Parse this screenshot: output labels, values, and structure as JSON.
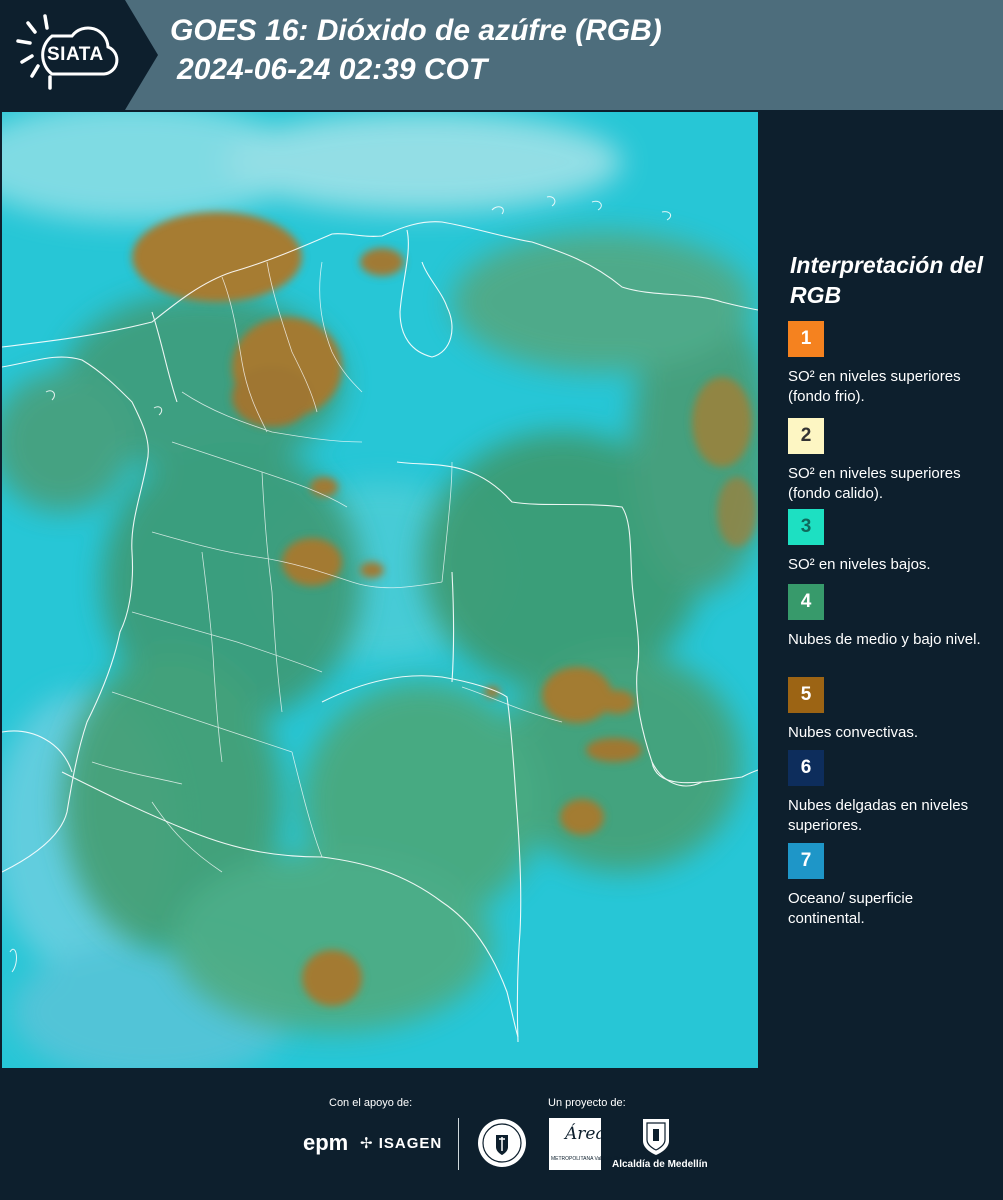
{
  "header": {
    "logo_text": "SIATA",
    "title_line1": "GOES 16: Dióxido de azúfre (RGB)",
    "title_line2": "2024-06-24 02:39 COT"
  },
  "map": {
    "product": "GOES 16: Dióxido de azúfre (RGB)",
    "colors": {
      "ocean_cyan": "#22c7d9",
      "low_cloud_green": "#3c9a72",
      "convective_tan": "#a37d30",
      "border_white": "#ffffff"
    }
  },
  "legend": {
    "title": "Interpretación del RGB",
    "items": [
      {
        "number": "1",
        "color": "#f5821f",
        "number_color": "#ffffff",
        "label": "SO² en niveles superiores (fondo frio)."
      },
      {
        "number": "2",
        "color": "#fdf6c3",
        "number_color": "#333333",
        "label": "SO² en niveles superiores (fondo calido)."
      },
      {
        "number": "3",
        "color": "#1de0c2",
        "number_color": "#0f6a5c",
        "label": "SO² en niveles bajos."
      },
      {
        "number": "4",
        "color": "#379a6b",
        "number_color": "#ffffff",
        "label": "Nubes de medio y bajo nivel."
      },
      {
        "number": "5",
        "color": "#9c6414",
        "number_color": "#ffffff",
        "label": "Nubes convectivas."
      },
      {
        "number": "6",
        "color": "#0d2d5c",
        "number_color": "#ffffff",
        "label": "Nubes delgadas en niveles superiores."
      },
      {
        "number": "7",
        "color": "#1e96c8",
        "number_color": "#ffffff",
        "label": "Oceano/ superficie continental."
      }
    ]
  },
  "footer": {
    "apoyo_label": "Con el apoyo de:",
    "proyecto_label": "Un proyecto de:",
    "epm": "epm",
    "isagen": "ISAGEN",
    "area_name": "Área",
    "area_sub": "METROPOLITANA Valle de Aburrá",
    "alcaldia": "Alcaldía de Medellín"
  }
}
